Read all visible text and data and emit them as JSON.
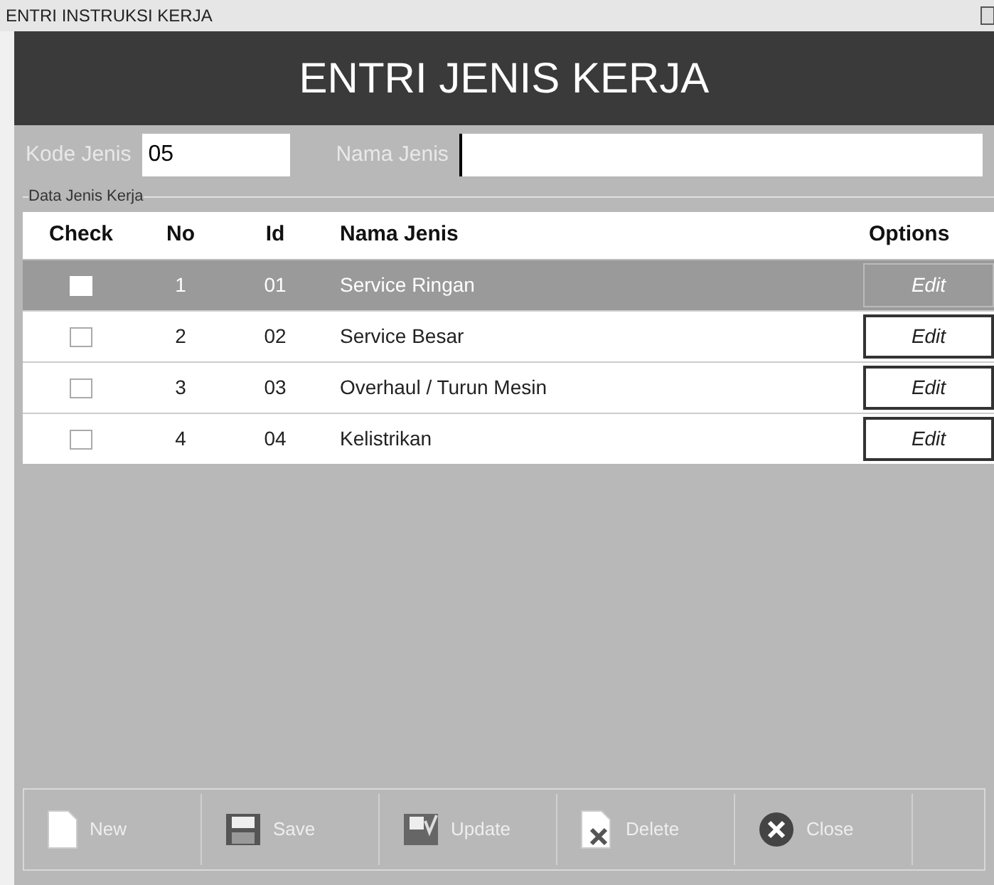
{
  "window": {
    "title": "ENTRI INSTRUKSI KERJA"
  },
  "header": {
    "title": "ENTRI JENIS KERJA"
  },
  "form": {
    "kode_label": "Kode Jenis",
    "kode_value": "05",
    "nama_label": "Nama Jenis"
  },
  "group": {
    "title": "Data Jenis Kerja"
  },
  "table": {
    "columns": [
      "Check",
      "No",
      "Id",
      "Nama Jenis",
      "Options"
    ],
    "rows": [
      {
        "selected": true,
        "checked": false,
        "no": "1",
        "id": "01",
        "nama": "Service Ringan",
        "option": "Edit"
      },
      {
        "selected": false,
        "checked": false,
        "no": "2",
        "id": "02",
        "nama": "Service Besar",
        "option": "Edit"
      },
      {
        "selected": false,
        "checked": false,
        "no": "3",
        "id": "03",
        "nama": "Overhaul / Turun Mesin",
        "option": "Edit"
      },
      {
        "selected": false,
        "checked": false,
        "no": "4",
        "id": "04",
        "nama": "Kelistrikan",
        "option": "Edit"
      }
    ]
  },
  "toolbar": [
    {
      "kind": "new",
      "label": "New"
    },
    {
      "kind": "save",
      "label": "Save"
    },
    {
      "kind": "update",
      "label": "Update"
    },
    {
      "kind": "delete",
      "label": "Delete"
    },
    {
      "kind": "close",
      "label": "Close"
    }
  ]
}
